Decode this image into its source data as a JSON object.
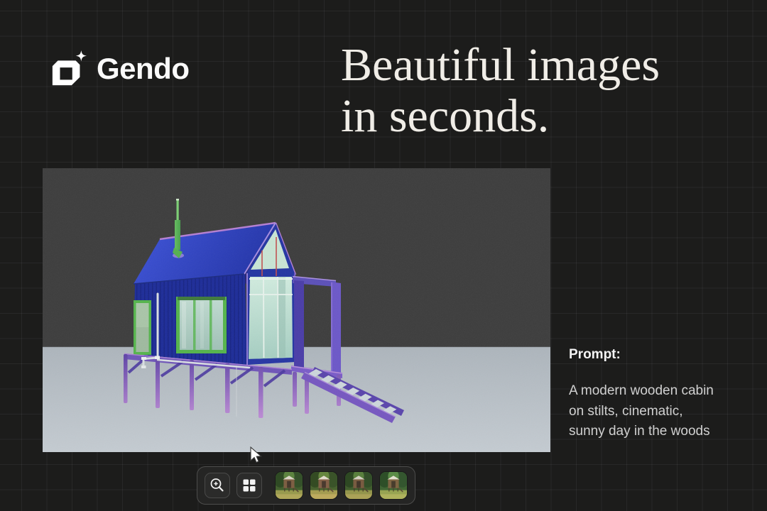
{
  "app": {
    "name": "Gendo"
  },
  "logo": {
    "text": "Gendo",
    "icon": "cube-sparkle-icon"
  },
  "headline": {
    "line1": "Beautiful images",
    "line2": "in seconds."
  },
  "viewer": {
    "description": "3D clay viewport render of a modern cabin on stilts with porch frame and stairs",
    "colors": {
      "background_top": "#3d3d3d",
      "floor": "#b9c1c8",
      "roof_blue": "#2a3fbe",
      "wall_blue": "#1d2c98",
      "window_frame_green": "#55b44c",
      "glass_mint": "#cde8dc",
      "structure_purple": "#7657c0",
      "chimney_green": "#5fb55a",
      "accent_red": "#c25050"
    }
  },
  "prompt": {
    "label": "Prompt:",
    "lines": [
      "A modern wooden cabin",
      "on stilts, cinematic,",
      "sunny day in the woods"
    ],
    "text": "A modern wooden cabin on stilts, cinematic, sunny day in the woods"
  },
  "toolbar": {
    "buttons": [
      {
        "name": "zoom-in",
        "icon": "zoom-in-icon"
      },
      {
        "name": "grid-view",
        "icon": "grid-view-icon"
      }
    ],
    "thumbnails": [
      {
        "name": "variation-1"
      },
      {
        "name": "variation-2"
      },
      {
        "name": "variation-3"
      },
      {
        "name": "variation-4"
      }
    ]
  },
  "page": {
    "background": "#1c1c1b",
    "grid_line": "rgba(255,255,255,0.055)",
    "text_primary": "#f0ede7",
    "text_secondary": "#d0d0d0"
  }
}
